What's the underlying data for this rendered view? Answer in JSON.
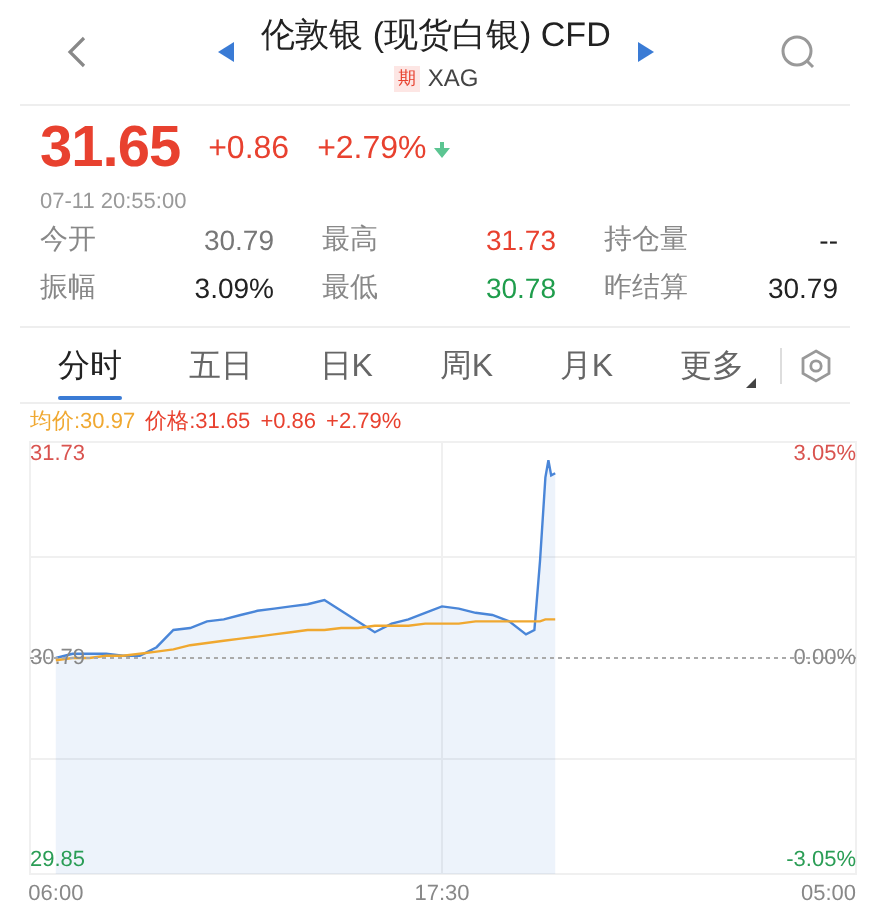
{
  "header": {
    "title": "伦敦银 (现货白银) CFD",
    "tag": "期",
    "symbol": "XAG"
  },
  "quote": {
    "price": "31.65",
    "change": "+0.86",
    "change_pct": "+2.79%",
    "timestamp": "07-11 20:55:00"
  },
  "stats": [
    {
      "label": "今开",
      "value": "30.79",
      "color": "#777777"
    },
    {
      "label": "最高",
      "value": "31.73",
      "color": "#e8412f"
    },
    {
      "label": "持仓量",
      "value": "--",
      "color": "#222222"
    },
    {
      "label": "振幅",
      "value": "3.09%",
      "color": "#222222"
    },
    {
      "label": "最低",
      "value": "30.78",
      "color": "#1f9d4c"
    },
    {
      "label": "昨结算",
      "value": "30.79",
      "color": "#222222"
    }
  ],
  "tabs": [
    {
      "label": "分时",
      "selected": true,
      "kind": "tab"
    },
    {
      "label": "五日",
      "selected": false,
      "kind": "tab"
    },
    {
      "label": "日K",
      "selected": false,
      "kind": "tab"
    },
    {
      "label": "周K",
      "selected": false,
      "kind": "tab"
    },
    {
      "label": "月K",
      "selected": false,
      "kind": "tab"
    },
    {
      "label": "更多",
      "selected": false,
      "kind": "dropdown"
    }
  ],
  "legend": {
    "avg": "均价:30.97",
    "price": "价格:31.65",
    "change": "+0.86",
    "change_pct": "+2.79%"
  },
  "chart": {
    "right_labels": [
      "3.05%",
      "0.00%",
      "-3.05%"
    ],
    "x_end_label": "05:00",
    "chart_data": {
      "type": "line",
      "x": [
        6,
        6.5,
        7,
        7.5,
        8,
        8.5,
        9,
        9.5,
        10,
        10.5,
        11,
        11.5,
        12,
        12.5,
        13,
        13.5,
        14,
        14.5,
        15,
        15.5,
        16,
        16.5,
        17,
        17.5,
        18,
        18.5,
        19,
        19.5,
        20,
        20.25,
        20.42,
        20.58,
        20.67,
        20.75,
        20.87
      ],
      "series": [
        {
          "color": "#4a86d8",
          "type": "area",
          "values": [
            30.79,
            30.81,
            30.81,
            30.81,
            30.8,
            30.8,
            30.84,
            30.92,
            30.93,
            30.96,
            30.97,
            30.99,
            31.01,
            31.02,
            31.03,
            31.04,
            31.06,
            31.01,
            30.96,
            30.91,
            30.95,
            30.97,
            31.0,
            31.03,
            31.02,
            31.0,
            30.99,
            30.96,
            30.9,
            30.92,
            31.24,
            31.63,
            31.71,
            31.64,
            31.65
          ]
        },
        {
          "color": "#f0a830",
          "type": "line",
          "values": [
            30.78,
            30.79,
            30.79,
            30.8,
            30.8,
            30.81,
            30.82,
            30.83,
            30.85,
            30.86,
            30.87,
            30.88,
            30.89,
            30.9,
            30.91,
            30.92,
            30.92,
            30.93,
            30.93,
            30.94,
            30.94,
            30.94,
            30.95,
            30.95,
            30.95,
            30.96,
            30.96,
            30.96,
            30.96,
            30.96,
            30.96,
            30.97,
            30.97,
            30.97,
            30.97
          ]
        }
      ],
      "xlim": [
        5.23,
        29.83
      ],
      "ylim": [
        29.785,
        31.795
      ],
      "xticks": [
        {
          "value": 6,
          "label": "06:00"
        },
        {
          "value": 17.5,
          "label": "17:30"
        }
      ],
      "yticks": [
        {
          "value": 31.73,
          "label": "31.73"
        },
        {
          "value": 30.79,
          "label": "30.79"
        },
        {
          "value": 29.85,
          "label": "29.85"
        }
      ],
      "ref_lines": [
        {
          "axis": "y",
          "value": 30.79
        }
      ]
    }
  }
}
